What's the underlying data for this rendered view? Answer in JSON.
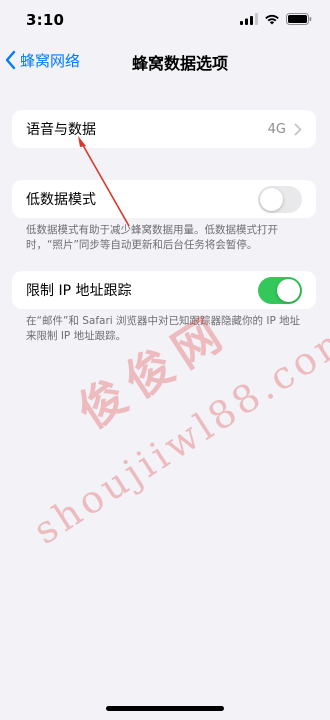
{
  "status_bar": {
    "time": "3:10",
    "icons": [
      "signal-icon",
      "wifi-icon",
      "battery-icon"
    ]
  },
  "nav": {
    "back_label": "蜂窝网络",
    "title": "蜂窝数据选项"
  },
  "groups": [
    {
      "rows": [
        {
          "label": "语音与数据",
          "value": "4G",
          "accessory": "chevron-right-icon"
        }
      ]
    },
    {
      "rows": [
        {
          "label": "低数据模式",
          "toggle": "off"
        }
      ],
      "footer": "低数据模式有助于减少蜂窝数据用量。低数据模式打开时，“照片”同步等自动更新和后台任务将会暂停。"
    },
    {
      "rows": [
        {
          "label": "限制 IP 地址跟踪",
          "toggle": "on"
        }
      ],
      "footer": "在“邮件”和 Safari 浏览器中对已知跟踪器隐藏你的 IP 地址来限制 IP 地址跟踪。"
    }
  ],
  "watermark": {
    "main": "俊俊网",
    "url": "shoujiiwl88.com"
  },
  "colors": {
    "accent": "#007aff",
    "toggle_on": "#34c759",
    "toggle_off": "#e9e9eb",
    "background": "#f2f2f7",
    "annotation": "#d63a2f"
  }
}
